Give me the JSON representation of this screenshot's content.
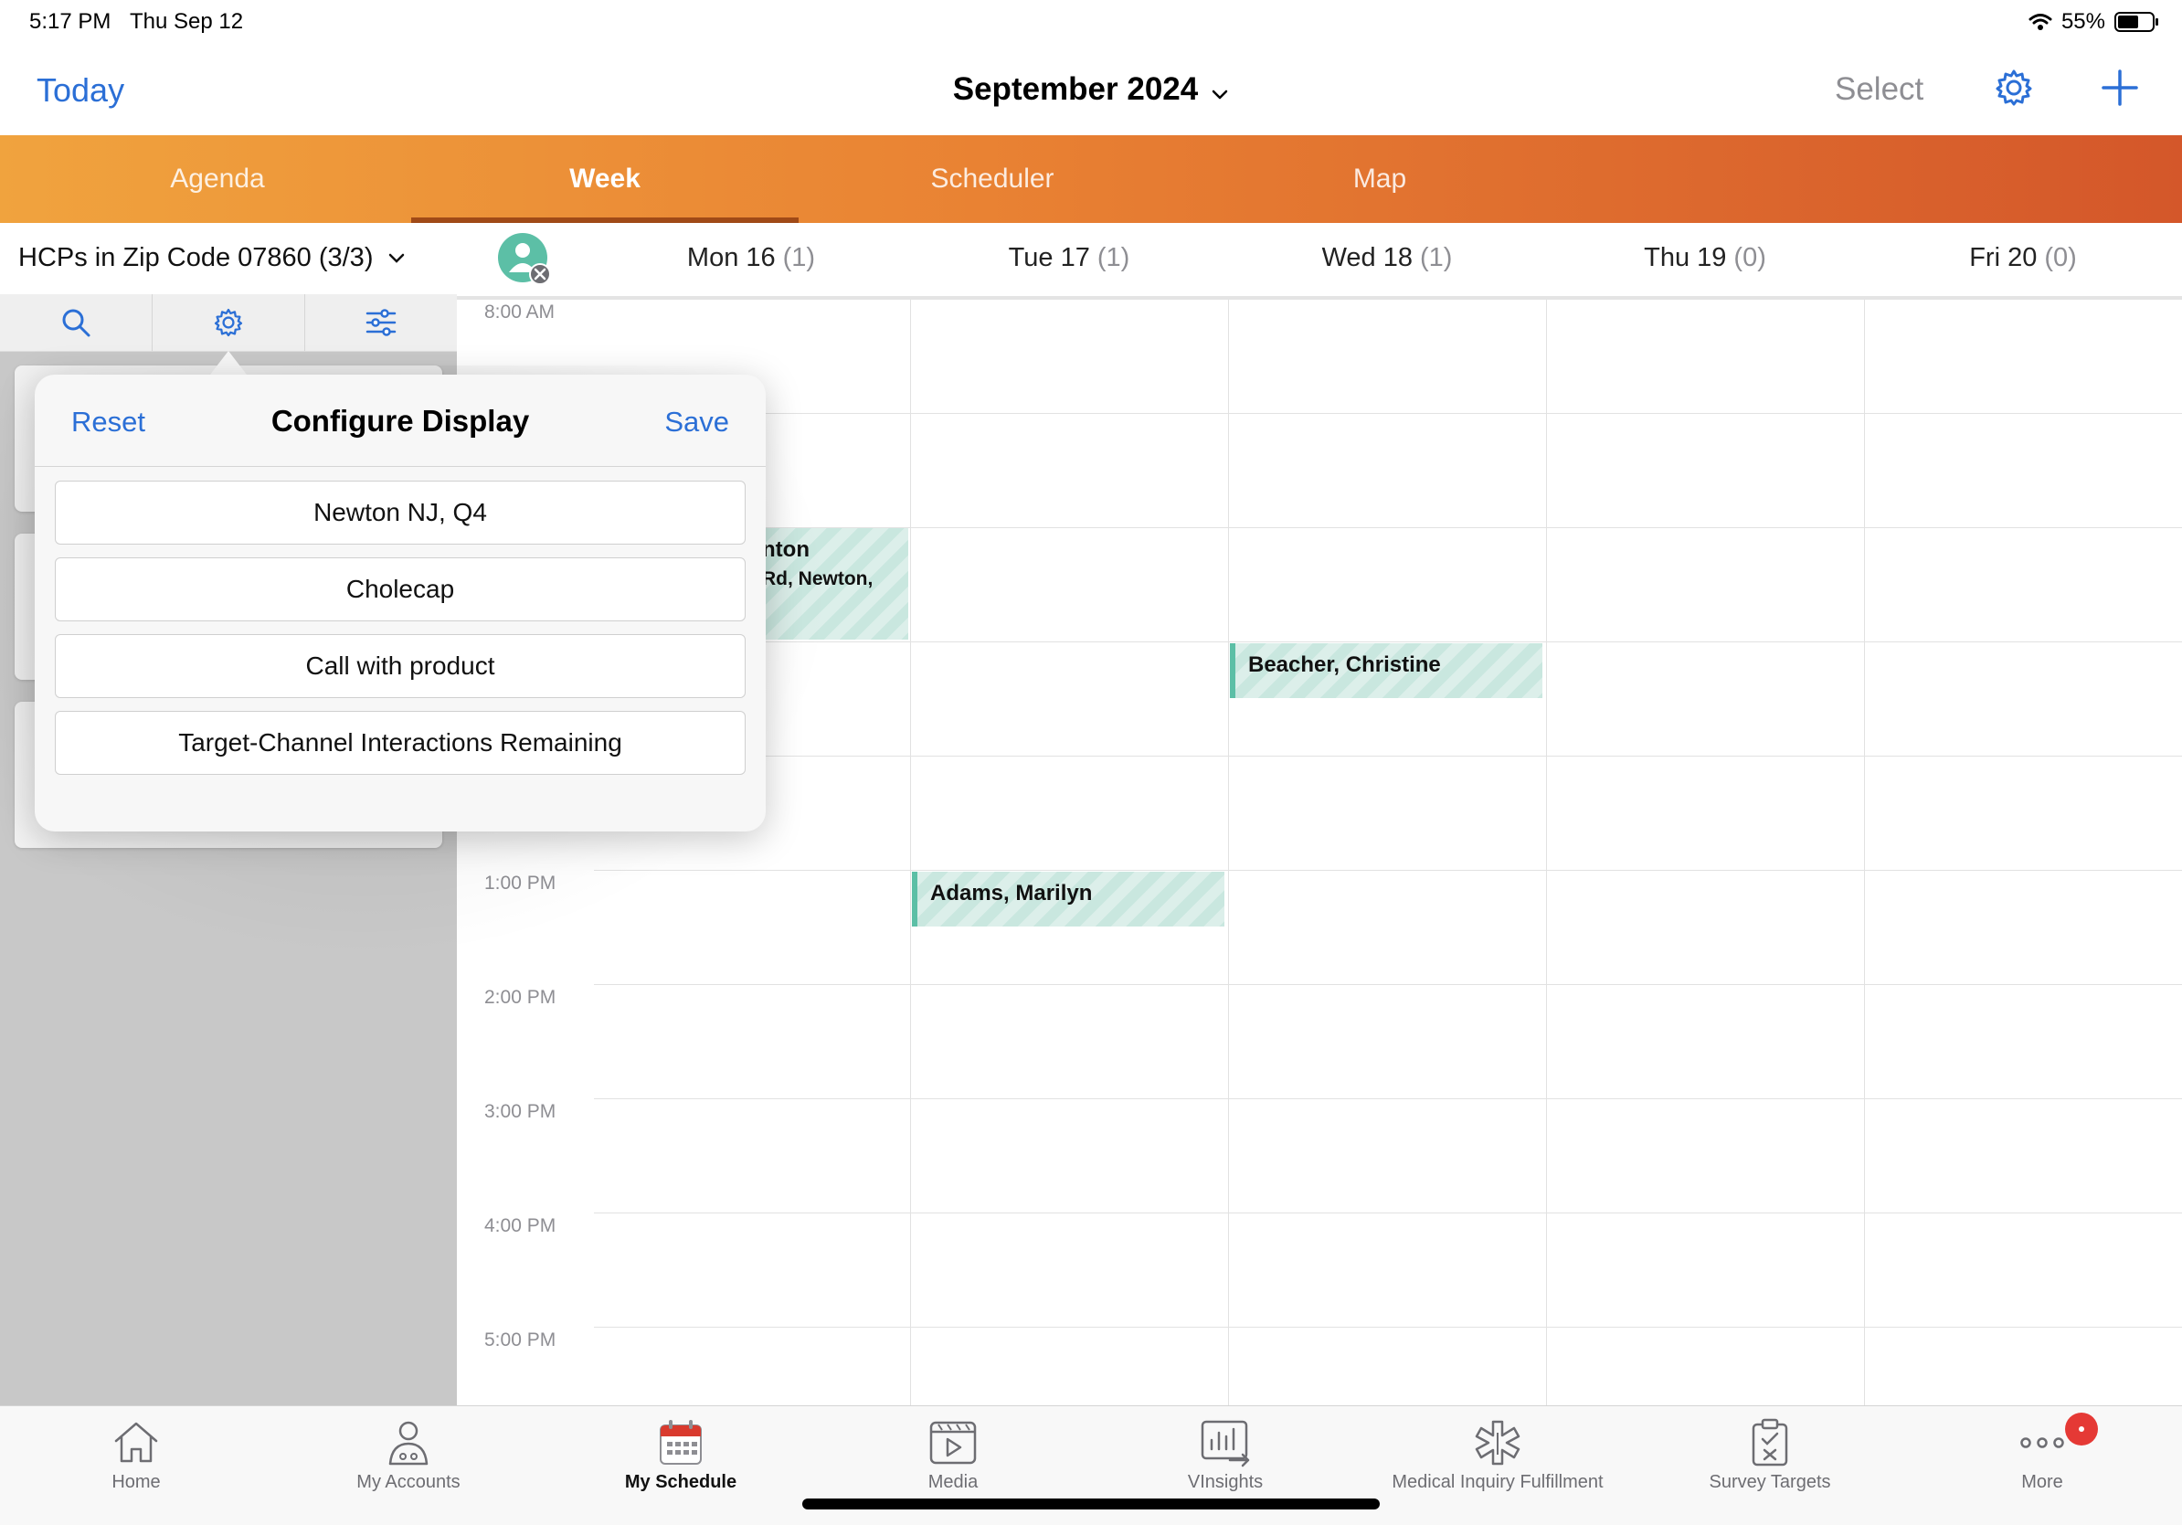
{
  "status_bar": {
    "time": "5:17 PM",
    "date": "Thu Sep 12",
    "battery": "55%"
  },
  "nav": {
    "today_label": "Today",
    "month_title": "September 2024",
    "select_label": "Select"
  },
  "tabs": [
    {
      "label": "Agenda",
      "active": false
    },
    {
      "label": "Week",
      "active": true
    },
    {
      "label": "Scheduler",
      "active": false
    },
    {
      "label": "Map",
      "active": false
    }
  ],
  "left_panel": {
    "filter_label": "HCPs in Zip Code 07860 (3/3)"
  },
  "week": {
    "days": [
      {
        "label": "Mon 16",
        "count": "(1)"
      },
      {
        "label": "Tue 17",
        "count": "(1)"
      },
      {
        "label": "Wed 18",
        "count": "(1)"
      },
      {
        "label": "Thu 19",
        "count": "(0)"
      },
      {
        "label": "Fri 20",
        "count": "(0)"
      }
    ],
    "time_labels": [
      "8:00 AM",
      "1:00 PM",
      "2:00 PM",
      "3:00 PM",
      "4:00 PM",
      "5:00 PM"
    ]
  },
  "events": [
    {
      "name": "nton",
      "address": "Rd, Newton,"
    },
    {
      "name": "Beacher, Christine"
    },
    {
      "name": "Adams, Marilyn"
    }
  ],
  "popover": {
    "reset_label": "Reset",
    "title": "Configure Display",
    "save_label": "Save",
    "items": [
      "Newton NJ, Q4",
      "Cholecap",
      "Call with product",
      "Target-Channel Interactions Remaining"
    ]
  },
  "bottom_tabs": [
    {
      "label": "Home",
      "icon": "house-icon"
    },
    {
      "label": "My Accounts",
      "icon": "person-icon"
    },
    {
      "label": "My Schedule",
      "icon": "calendar-icon",
      "active": true
    },
    {
      "label": "Media",
      "icon": "media-play-icon"
    },
    {
      "label": "VInsights",
      "icon": "chart-icon"
    },
    {
      "label": "Medical Inquiry Fulfillment",
      "icon": "medical-star-icon"
    },
    {
      "label": "Survey Targets",
      "icon": "clipboard-icon"
    },
    {
      "label": "More",
      "icon": "more-dots-icon"
    }
  ],
  "colors": {
    "accent": "#2b6fd6",
    "tab_gradient_start": "#f0a33e",
    "tab_gradient_end": "#d4572a",
    "event": "#5cbfa6",
    "badge": "#e53935"
  }
}
